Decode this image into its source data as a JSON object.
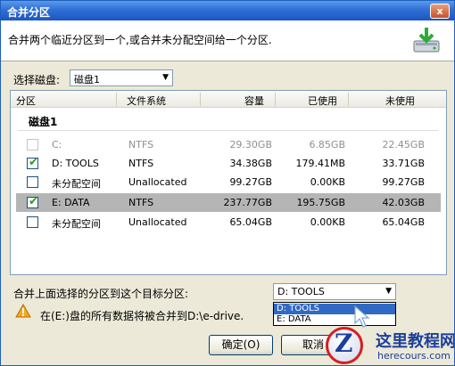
{
  "window": {
    "title": "合并分区",
    "close_label": "x"
  },
  "header": {
    "description": "合并两个临近分区到一个,或合并未分配空间给一个分区."
  },
  "disk_select": {
    "label": "选择磁盘:",
    "value": "磁盘1"
  },
  "table": {
    "columns": [
      "分区",
      "文件系统",
      "容量",
      "已使用",
      "未使用"
    ],
    "disk_name": "磁盘1",
    "rows": [
      {
        "checked": false,
        "disabled": true,
        "selected": false,
        "partition": "C:",
        "fs": "NTFS",
        "capacity": "29.30GB",
        "used": "6.85GB",
        "free": "22.45GB"
      },
      {
        "checked": true,
        "disabled": false,
        "selected": false,
        "partition": "D:  TOOLS",
        "fs": "NTFS",
        "capacity": "34.38GB",
        "used": "179.41MB",
        "free": "33.71GB"
      },
      {
        "checked": false,
        "disabled": false,
        "selected": false,
        "partition": "未分配空间",
        "fs": "Unallocated",
        "capacity": "99.27GB",
        "used": "0.00KB",
        "free": "99.27GB"
      },
      {
        "checked": true,
        "disabled": false,
        "selected": true,
        "partition": "E:  DATA",
        "fs": "NTFS",
        "capacity": "237.77GB",
        "used": "195.75GB",
        "free": "42.03GB"
      },
      {
        "checked": false,
        "disabled": false,
        "selected": false,
        "partition": "未分配空间",
        "fs": "Unallocated",
        "capacity": "65.04GB",
        "used": "0.00KB",
        "free": "65.04GB"
      }
    ]
  },
  "target": {
    "label": "合并上面选择的分区到这个目标分区:",
    "value": "D:  TOOLS",
    "options": [
      "D:  TOOLS",
      "E:  DATA"
    ],
    "highlighted_index": 0
  },
  "warning": {
    "text": "在(E:)盘的所有数据将被合并到D:\\e-drive."
  },
  "buttons": {
    "ok": "确定(O)",
    "cancel": "取消"
  },
  "watermark": {
    "logo_letter": "Z",
    "cn": "这里教程网",
    "en": "herecours.com"
  },
  "colors": {
    "selection": "#b5b5b5",
    "highlight": "#316ac5",
    "check": "#21a121",
    "title": "#2f6fd6"
  }
}
